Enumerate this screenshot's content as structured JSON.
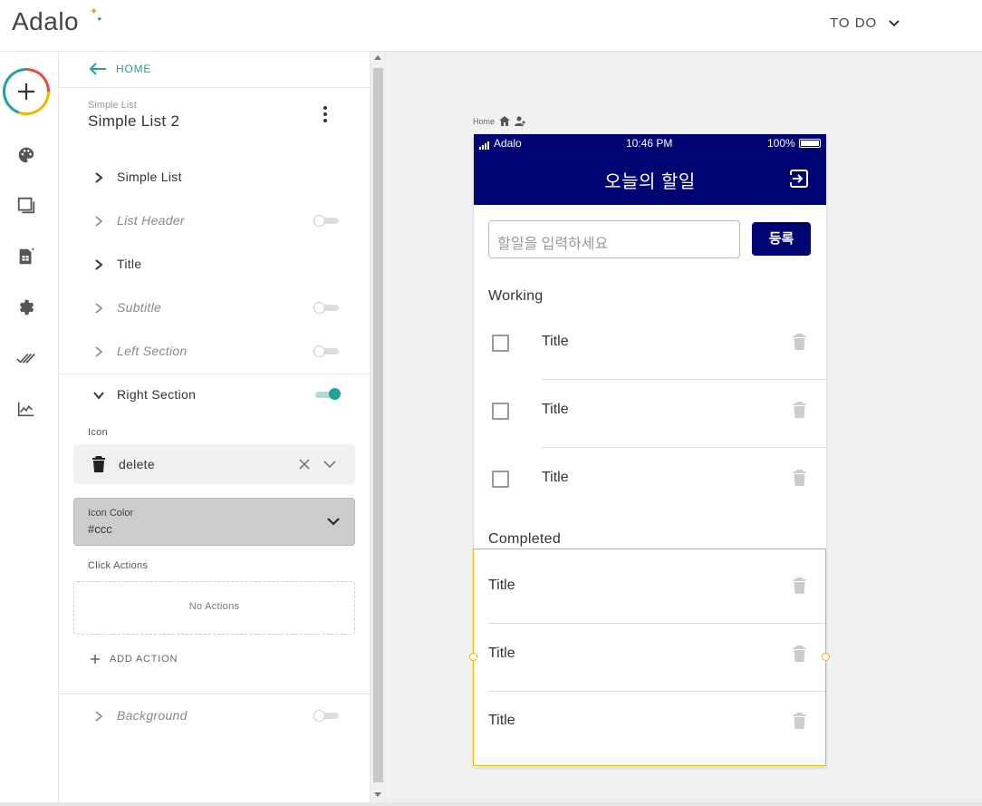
{
  "header": {
    "logo": "Adalo",
    "app_name": "TO DO"
  },
  "panel": {
    "back_label": "HOME",
    "component_type": "Simple List",
    "component_name": "Simple List 2",
    "rows": [
      {
        "label": "Simple List",
        "enabled": true
      },
      {
        "label": "List Header",
        "enabled": false
      },
      {
        "label": "Title",
        "enabled": true
      },
      {
        "label": "Subtitle",
        "enabled": false
      },
      {
        "label": "Left Section",
        "enabled": false
      }
    ],
    "right_section": {
      "label": "Right Section",
      "enabled": true,
      "icon_label": "Icon",
      "icon_value": "delete",
      "icon_color_label": "Icon Color",
      "icon_color_value": "#ccc",
      "click_actions_label": "Click Actions",
      "no_actions": "No Actions",
      "add_action": "ADD ACTION"
    },
    "background": {
      "label": "Background",
      "enabled": false
    }
  },
  "canvas": {
    "breadcrumb": "Home",
    "status": {
      "carrier": "Adalo",
      "time": "10:46 PM",
      "battery": "100%"
    },
    "app_title": "오늘의 할일",
    "input_placeholder": "할일을 입력하세요",
    "submit_label": "등록",
    "working_heading": "Working",
    "working_items": [
      "Title",
      "Title",
      "Title"
    ],
    "completed_heading": "Completed",
    "completed_items": [
      "Title",
      "Title",
      "Title"
    ]
  },
  "colors": {
    "accent": "#1fa39a",
    "app_bar": "#000372",
    "selection": "#f0b400",
    "icon_color": "#cccccc"
  }
}
